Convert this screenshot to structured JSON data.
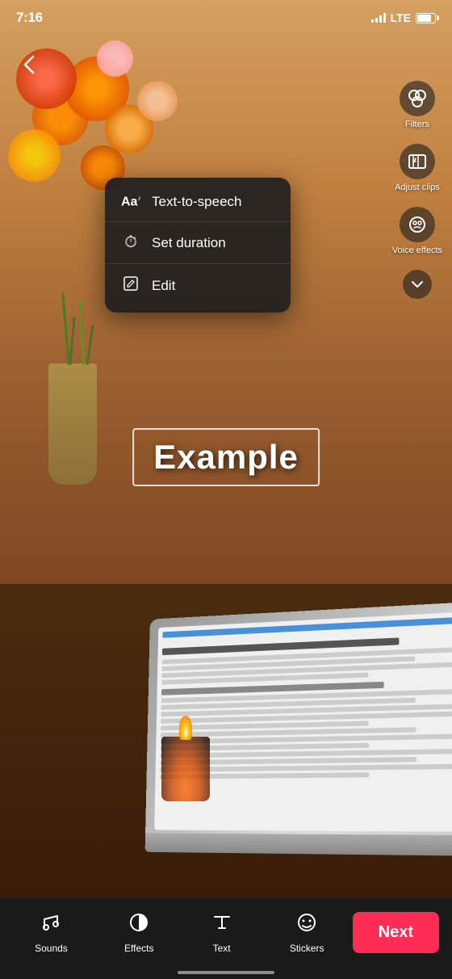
{
  "statusBar": {
    "time": "7:16",
    "signal": "LTE",
    "batteryLevel": 80
  },
  "toolbar": {
    "filters_label": "Filters",
    "adjust_clips_label": "Adjust clips",
    "voice_effects_label": "Voice effects"
  },
  "contextMenu": {
    "items": [
      {
        "id": "text-to-speech",
        "icon": "Aa",
        "label": "Text-to-speech"
      },
      {
        "id": "set-duration",
        "icon": "⏱",
        "label": "Set duration"
      },
      {
        "id": "edit",
        "icon": "✏",
        "label": "Edit"
      }
    ]
  },
  "textOverlay": {
    "text": "Example"
  },
  "bottomBar": {
    "tabs": [
      {
        "id": "sounds",
        "icon": "♫",
        "label": "Sounds"
      },
      {
        "id": "effects",
        "icon": "◑",
        "label": "Effects"
      },
      {
        "id": "text",
        "icon": "Aa",
        "label": "Text"
      },
      {
        "id": "stickers",
        "icon": "☺",
        "label": "Stickers"
      }
    ],
    "next_button": "Next"
  },
  "scene": {
    "back_button": "‹"
  }
}
